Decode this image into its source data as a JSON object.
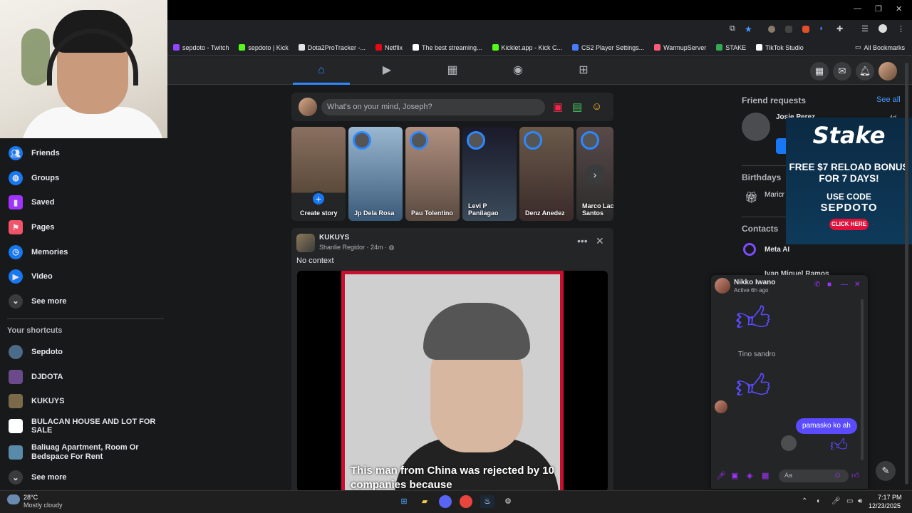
{
  "bookmarks": [
    {
      "label": "sepdoto - Twitch",
      "color": "#9146ff"
    },
    {
      "label": "sepdoto | Kick",
      "color": "#53fc18"
    },
    {
      "label": "Dota2ProTracker -...",
      "color": "#e4e6eb"
    },
    {
      "label": "Netflix",
      "color": "#e50914"
    },
    {
      "label": "The best streaming...",
      "color": "#ffffff"
    },
    {
      "label": "Kicklet.app - Kick C...",
      "color": "#53fc18"
    },
    {
      "label": "CS2 Player Settings...",
      "color": "#4a7bff"
    },
    {
      "label": "WarmupServer",
      "color": "#ff5a7a"
    },
    {
      "label": "STAKE",
      "color": "#34a853"
    },
    {
      "label": "TikTok Studio",
      "color": "#ffffff"
    }
  ],
  "all_bookmarks": "All Bookmarks",
  "sidebar": {
    "items": [
      {
        "label": "Friends",
        "icon": "friends-icon",
        "color": "#1877f2"
      },
      {
        "label": "Groups",
        "icon": "groups-icon",
        "color": "#1877f2"
      },
      {
        "label": "Saved",
        "icon": "bookmark-icon",
        "color": "#a033ff"
      },
      {
        "label": "Pages",
        "icon": "flag-icon",
        "color": "#f35369"
      },
      {
        "label": "Memories",
        "icon": "clock-icon",
        "color": "#1877f2"
      },
      {
        "label": "Video",
        "icon": "video-icon",
        "color": "#1877f2"
      },
      {
        "label": "See more",
        "icon": "chevron-down-icon",
        "color": "#3a3b3c"
      }
    ],
    "shortcuts_title": "Your shortcuts",
    "shortcuts": [
      {
        "label": "Sepdoto",
        "color": "#4b6b8a"
      },
      {
        "label": "DJDOTA",
        "color": "#6a4a8a"
      },
      {
        "label": "KUKUYS",
        "color": "#7a6a4a"
      },
      {
        "label": "BULACAN HOUSE AND LOT FOR SALE",
        "color": "#ffffff"
      },
      {
        "label": "Baliuag Apartment, Room Or Bedspace For Rent",
        "color": "#5a8aaa"
      },
      {
        "label": "See more",
        "color": "#3a3b3c"
      }
    ]
  },
  "composer": {
    "placeholder": "What's on your mind, Joseph?"
  },
  "stories": [
    {
      "name": "Create story",
      "bg": "#6b5a4a"
    },
    {
      "name": "Jp Dela Rosa",
      "bg": "#5a7a9a"
    },
    {
      "name": "Pau Tolentino",
      "bg": "#7a6a5a"
    },
    {
      "name": "Levi P Panilagao",
      "bg": "#1a2a3a"
    },
    {
      "name": "Denz Anedez",
      "bg": "#5a4a3a"
    },
    {
      "name": "Marco Lacs Santos",
      "bg": "#4a3a3a"
    }
  ],
  "post": {
    "group": "KUKUYS",
    "author": "Shanlie Regidor",
    "time": "24m",
    "text": "No context",
    "caption": "This man from China was rejected by 10 companies because"
  },
  "right": {
    "friend_requests_title": "Friend requests",
    "see_all": "See all",
    "request_name": "Josie Perez",
    "request_time": "4d",
    "birthdays_title": "Birthdays",
    "birthday_text": "Maricr birthd",
    "contacts_title": "Contacts",
    "contacts": [
      "Meta AI",
      "Ivan Miguel Ramos"
    ]
  },
  "ad": {
    "logo": "Stake",
    "offer": "FREE $7 RELOAD BONUS FOR 7 DAYS!",
    "use_code": "USE CODE",
    "code": "SEPDOTO",
    "button": "CLICK HERE"
  },
  "chat": {
    "name": "Nikko Iwano",
    "status": "Active 6h ago",
    "note": "Tino sandro",
    "my_message": "pamasko ko ah",
    "input_placeholder": "Aa"
  },
  "taskbar": {
    "temp": "28°C",
    "weather": "Mostly cloudy",
    "time": "7:17 PM",
    "date": "12/23/2025"
  }
}
